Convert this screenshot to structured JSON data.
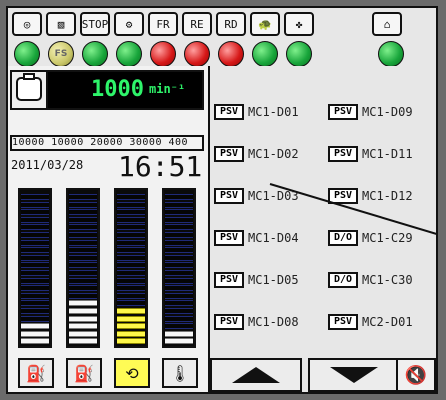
{
  "rpm": {
    "value": "1000",
    "unit": "min⁻¹"
  },
  "hours_text": "10000 10000 20000 30000 400",
  "datetime": {
    "date": "2011/03/28",
    "time": "16:51"
  },
  "items": [
    {
      "tag": "PSV",
      "label": "MC1-D01"
    },
    {
      "tag": "PSV",
      "label": "MC1-D09"
    },
    {
      "tag": "PSV",
      "label": "MC1-D02"
    },
    {
      "tag": "PSV",
      "label": "MC1-D11"
    },
    {
      "tag": "PSV",
      "label": "MC1-D03"
    },
    {
      "tag": "PSV",
      "label": "MC1-D12"
    },
    {
      "tag": "PSV",
      "label": "MC1-D04"
    },
    {
      "tag": "D/O",
      "label": "MC1-C29"
    },
    {
      "tag": "PSV",
      "label": "MC1-D05"
    },
    {
      "tag": "D/O",
      "label": "MC1-C30"
    },
    {
      "tag": "PSV",
      "label": "MC1-D08"
    },
    {
      "tag": "PSV",
      "label": "MC2-D01"
    }
  ],
  "icons_top": [
    {
      "name": "engine-icon",
      "glyph": "◎"
    },
    {
      "name": "filter-icon",
      "glyph": "▧"
    },
    {
      "name": "stop-icon",
      "glyph": "STOP"
    },
    {
      "name": "network-icon",
      "glyph": "⚙"
    },
    {
      "name": "fr-icon",
      "glyph": "FR"
    },
    {
      "name": "re-icon",
      "glyph": "RE"
    },
    {
      "name": "rd-icon",
      "glyph": "RD"
    },
    {
      "name": "turtle-icon",
      "glyph": "🐢"
    },
    {
      "name": "fan-icon",
      "glyph": "✤"
    },
    {
      "name": "key-icon",
      "glyph": "⌂"
    }
  ],
  "lamps": [
    {
      "state": "green"
    },
    {
      "state": "yellow",
      "label": "FS"
    },
    {
      "state": "green"
    },
    {
      "state": "green"
    },
    {
      "state": "red"
    },
    {
      "state": "red"
    },
    {
      "state": "red"
    },
    {
      "state": "green"
    },
    {
      "state": "green"
    },
    {
      "state": "green"
    }
  ],
  "bars": [
    {
      "name": "bar-1",
      "colors": [
        "white",
        "white",
        "white"
      ],
      "icon": "⛽"
    },
    {
      "name": "bar-2",
      "colors": [
        "white",
        "white",
        "white",
        "white",
        "white",
        "white"
      ],
      "icon": "⛽"
    },
    {
      "name": "bar-3",
      "colors": [
        "yellow",
        "yellow",
        "yellow",
        "yellow",
        "yellow"
      ],
      "icon": "⟲"
    },
    {
      "name": "bar-4",
      "colors": [
        "white",
        "white"
      ],
      "icon": "🌡"
    }
  ],
  "pager": {
    "up_label": "",
    "down_label": "",
    "mute_label": "🔇"
  }
}
